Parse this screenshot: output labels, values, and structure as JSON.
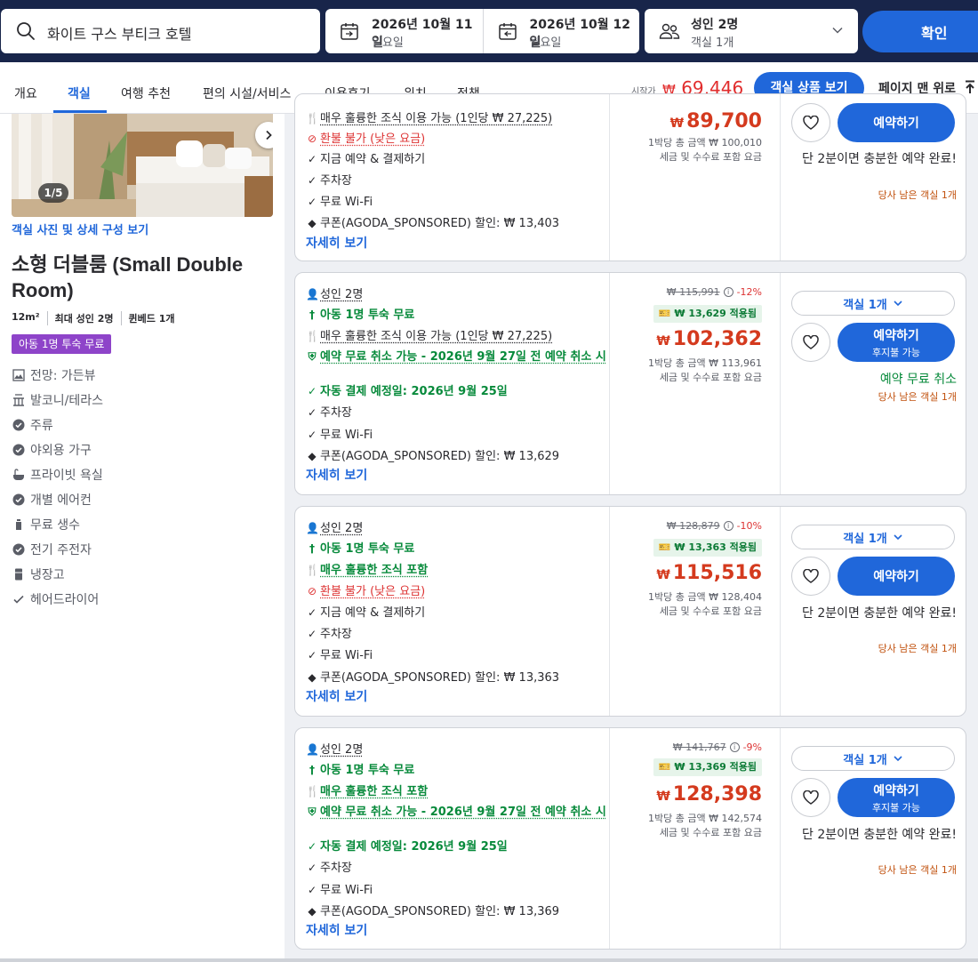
{
  "search": {
    "query": "화이트 구스 부티크 호텔",
    "checkin_date": "2026년 10월 11일",
    "checkin_day": "일요일",
    "checkout_date": "2026년 10월 12일",
    "checkout_day": "월요일",
    "guests_main": "성인 2명",
    "guests_sub": "객실 1개",
    "confirm_label": "확인"
  },
  "nav": {
    "tabs": [
      "개요",
      "객실",
      "여행 추천",
      "편의 시설/서비스",
      "이용후기",
      "위치",
      "정책"
    ],
    "active_tab": "객실",
    "from_label": "시작가",
    "from_currency": "₩",
    "from_price": "69,446",
    "view_rooms_label": "객실 상품 보기",
    "back_to_top_label": "페이지 맨 위로"
  },
  "room": {
    "photo_counter": "1/5",
    "photo_link": "객실 사진 및 상세 구성 보기",
    "title": "소형 더블룸 (Small Double Room)",
    "specs": [
      "12m²",
      "최대 성인 2명",
      "퀸베드 1개"
    ],
    "badge": "아동 1명 투숙 무료",
    "amenities": [
      {
        "icon": "view-icon",
        "label": "전망: 가든뷰"
      },
      {
        "icon": "balcony-icon",
        "label": "발코니/테라스"
      },
      {
        "icon": "check-circle-icon",
        "label": "주류"
      },
      {
        "icon": "check-circle-icon",
        "label": "야외용 가구"
      },
      {
        "icon": "bathtub-icon",
        "label": "프라이빗 욕실"
      },
      {
        "icon": "check-circle-icon",
        "label": "개별 에어컨"
      },
      {
        "icon": "water-bottle-icon",
        "label": "무료 생수"
      },
      {
        "icon": "check-circle-icon",
        "label": "전기 주전자"
      },
      {
        "icon": "fridge-icon",
        "label": "냉장고"
      },
      {
        "icon": "check-icon",
        "label": "헤어드라이어"
      }
    ]
  },
  "offers": [
    {
      "features": [
        {
          "icon": "breakfast-icon",
          "text": "매우 훌륭한 조식 이용 가능 (1인당 ₩ 27,225)",
          "style": "plain"
        },
        {
          "icon": "no-refund-icon",
          "text": "환불 불가 (낮은 요금)",
          "style": "red"
        },
        {
          "icon": "check-icon",
          "text": "지금 예약 & 결제하기",
          "style": "plain"
        },
        {
          "icon": "check-icon",
          "text": "주차장",
          "style": "plain"
        },
        {
          "icon": "check-icon",
          "text": "무료 Wi-Fi",
          "style": "plain"
        },
        {
          "icon": "coupon-tag-icon",
          "text": "쿠폰(AGODA_SPONSORED) 할인: ₩ 13,403",
          "style": "plain"
        }
      ],
      "more_label": "자세히 보기",
      "currency": "₩",
      "price": "89,700",
      "night_total": "1박당 총 금액 ₩ 100,010",
      "tax_note": "세금 및 수수료 포함 요금",
      "book_label": "예약하기",
      "note": "단 2분이면 충분한 예약 완료!",
      "rooms_left": "당사 남은 객실 1개"
    },
    {
      "features": [
        {
          "icon": "person-icon",
          "text": "성인 2명",
          "style": "plain"
        },
        {
          "icon": "child-icon",
          "text": "아동 1명 투숙 무료",
          "style": "green"
        },
        {
          "icon": "breakfast-icon",
          "text": "매우 훌륭한 조식 이용 가능 (1인당 ₩ 27,225)",
          "style": "plain"
        },
        {
          "icon": "shield-check-icon",
          "text": "예약 무료 취소 가능 - 2026년 9월 27일 전 예약 취소 시",
          "style": "green"
        },
        {
          "icon": "check-icon",
          "text": "자동 결제 예정일: 2026년 9월 25일",
          "style": "green"
        },
        {
          "icon": "check-icon",
          "text": "주차장",
          "style": "plain"
        },
        {
          "icon": "check-icon",
          "text": "무료 Wi-Fi",
          "style": "plain"
        },
        {
          "icon": "coupon-tag-icon",
          "text": "쿠폰(AGODA_SPONSORED) 할인: ₩ 13,629",
          "style": "plain"
        }
      ],
      "more_label": "자세히 보기",
      "original_price": "₩ 115,991",
      "discount": "-12%",
      "coupon_chip": "₩ 13,629 적용됨",
      "currency": "₩",
      "price": "102,362",
      "night_total": "1박당 총 금액 ₩ 113,961",
      "tax_note": "세금 및 수수료 포함 요금",
      "rooms_select": "객실 1개",
      "book_label": "예약하기",
      "book_sub": "후지불 가능",
      "note": "예약 무료 취소",
      "rooms_left": "당사 남은 객실 1개"
    },
    {
      "features": [
        {
          "icon": "person-icon",
          "text": "성인 2명",
          "style": "plain"
        },
        {
          "icon": "child-icon",
          "text": "아동 1명 투숙 무료",
          "style": "green"
        },
        {
          "icon": "breakfast-icon",
          "text": "매우 훌륭한 조식 포함",
          "style": "green"
        },
        {
          "icon": "no-refund-icon",
          "text": "환불 불가 (낮은 요금)",
          "style": "red"
        },
        {
          "icon": "check-icon",
          "text": "지금 예약 & 결제하기",
          "style": "plain"
        },
        {
          "icon": "check-icon",
          "text": "주차장",
          "style": "plain"
        },
        {
          "icon": "check-icon",
          "text": "무료 Wi-Fi",
          "style": "plain"
        },
        {
          "icon": "coupon-tag-icon",
          "text": "쿠폰(AGODA_SPONSORED) 할인: ₩ 13,363",
          "style": "plain"
        }
      ],
      "more_label": "자세히 보기",
      "original_price": "₩ 128,879",
      "discount": "-10%",
      "coupon_chip": "₩ 13,363 적용됨",
      "currency": "₩",
      "price": "115,516",
      "night_total": "1박당 총 금액 ₩ 128,404",
      "tax_note": "세금 및 수수료 포함 요금",
      "rooms_select": "객실 1개",
      "book_label": "예약하기",
      "note": "단 2분이면 충분한 예약 완료!",
      "rooms_left": "당사 남은 객실 1개"
    },
    {
      "features": [
        {
          "icon": "person-icon",
          "text": "성인 2명",
          "style": "plain"
        },
        {
          "icon": "child-icon",
          "text": "아동 1명 투숙 무료",
          "style": "green"
        },
        {
          "icon": "breakfast-icon",
          "text": "매우 훌륭한 조식 포함",
          "style": "green"
        },
        {
          "icon": "shield-check-icon",
          "text": "예약 무료 취소 가능 - 2026년 9월 27일 전 예약 취소 시",
          "style": "green"
        },
        {
          "icon": "check-icon",
          "text": "자동 결제 예정일: 2026년 9월 25일",
          "style": "green"
        },
        {
          "icon": "check-icon",
          "text": "주차장",
          "style": "plain"
        },
        {
          "icon": "check-icon",
          "text": "무료 Wi-Fi",
          "style": "plain"
        },
        {
          "icon": "coupon-tag-icon",
          "text": "쿠폰(AGODA_SPONSORED) 할인: ₩ 13,369",
          "style": "plain"
        }
      ],
      "more_label": "자세히 보기",
      "original_price": "₩ 141,767",
      "discount": "-9%",
      "coupon_chip": "₩ 13,369 적용됨",
      "currency": "₩",
      "price": "128,398",
      "night_total": "1박당 총 금액 ₩ 142,574",
      "tax_note": "세금 및 수수료 포함 요금",
      "rooms_select": "객실 1개",
      "book_label": "예약하기",
      "book_sub": "후지불 가능",
      "note": "단 2분이면 충분한 예약 완료!",
      "rooms_left": "당사 남은 객실 1개"
    }
  ],
  "colors": {
    "header_bg": "#18254a",
    "accent_blue": "#2067da",
    "price_red": "#d43a1e",
    "green": "#078a3b",
    "badge_purple": "#8e44c9"
  }
}
